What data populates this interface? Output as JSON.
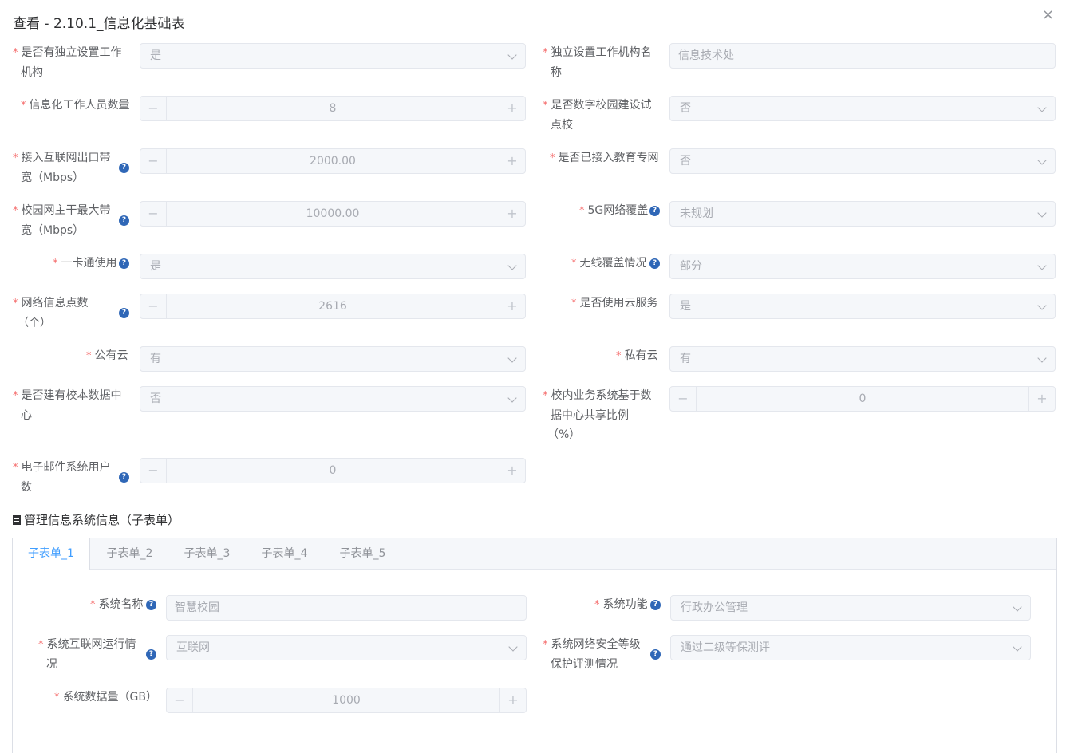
{
  "title": "查看 - 2.10.1_信息化基础表",
  "close_icon": "×",
  "required_mark": "*",
  "help_glyph": "?",
  "fields": {
    "independent_org": {
      "label1": "是否有独立设置工作",
      "label2": "机构",
      "value": "是"
    },
    "org_name": {
      "label1": "独立设置工作机构名",
      "label2": "称",
      "value": "信息技术处"
    },
    "staff_count": {
      "label1": "信息化工作人员数量",
      "value": "8"
    },
    "digital_pilot": {
      "label1": "是否数字校园建设试",
      "label2": "点校",
      "value": "否"
    },
    "bandwidth_out": {
      "label1": "接入互联网出口带",
      "label2": "宽（Mbps）",
      "value": "2000.00"
    },
    "edu_network": {
      "label1": "是否已接入教育专网",
      "value": "否"
    },
    "backbone_bw": {
      "label1": "校园网主干最大带",
      "label2": "宽（Mbps）",
      "value": "10000.00"
    },
    "coverage_5g": {
      "label1": "5G网络覆盖",
      "value": "未规划"
    },
    "card_usage": {
      "label1": "一卡通使用",
      "value": "是"
    },
    "wireless": {
      "label1": "无线覆盖情况",
      "value": "部分"
    },
    "info_points": {
      "label1": "网络信息点数",
      "label2": "（个）",
      "value": "2616"
    },
    "cloud_service": {
      "label1": "是否使用云服务",
      "value": "是"
    },
    "public_cloud": {
      "label1": "公有云",
      "value": "有"
    },
    "private_cloud": {
      "label1": "私有云",
      "value": "有"
    },
    "data_center": {
      "label1": "是否建有校本数据中",
      "label2": "心",
      "value": "否"
    },
    "share_ratio": {
      "label1": "校内业务系统基于数",
      "label2": "据中心共享比例",
      "label3": "（%）",
      "value": "0"
    },
    "email_users": {
      "label1": "电子邮件系统用户",
      "label2": "数",
      "value": "0"
    }
  },
  "section": {
    "title": "管理信息系统信息（子表单）"
  },
  "tabs": [
    "子表单_1",
    "子表单_2",
    "子表单_3",
    "子表单_4",
    "子表单_5"
  ],
  "subform": {
    "sys_name": {
      "label1": "系统名称",
      "value": "智慧校园"
    },
    "sys_function": {
      "label1": "系统功能",
      "value": "行政办公管理"
    },
    "sys_internet": {
      "label1": "系统互联网运行情",
      "label2": "况",
      "value": "互联网"
    },
    "sys_security": {
      "label1": "系统网络安全等级",
      "label2": "保护评测情况",
      "value": "通过二级等保测评"
    },
    "sys_data": {
      "label1": "系统数据量（GB）",
      "value": "1000"
    }
  },
  "stepper": {
    "minus": "−",
    "plus": "+"
  }
}
